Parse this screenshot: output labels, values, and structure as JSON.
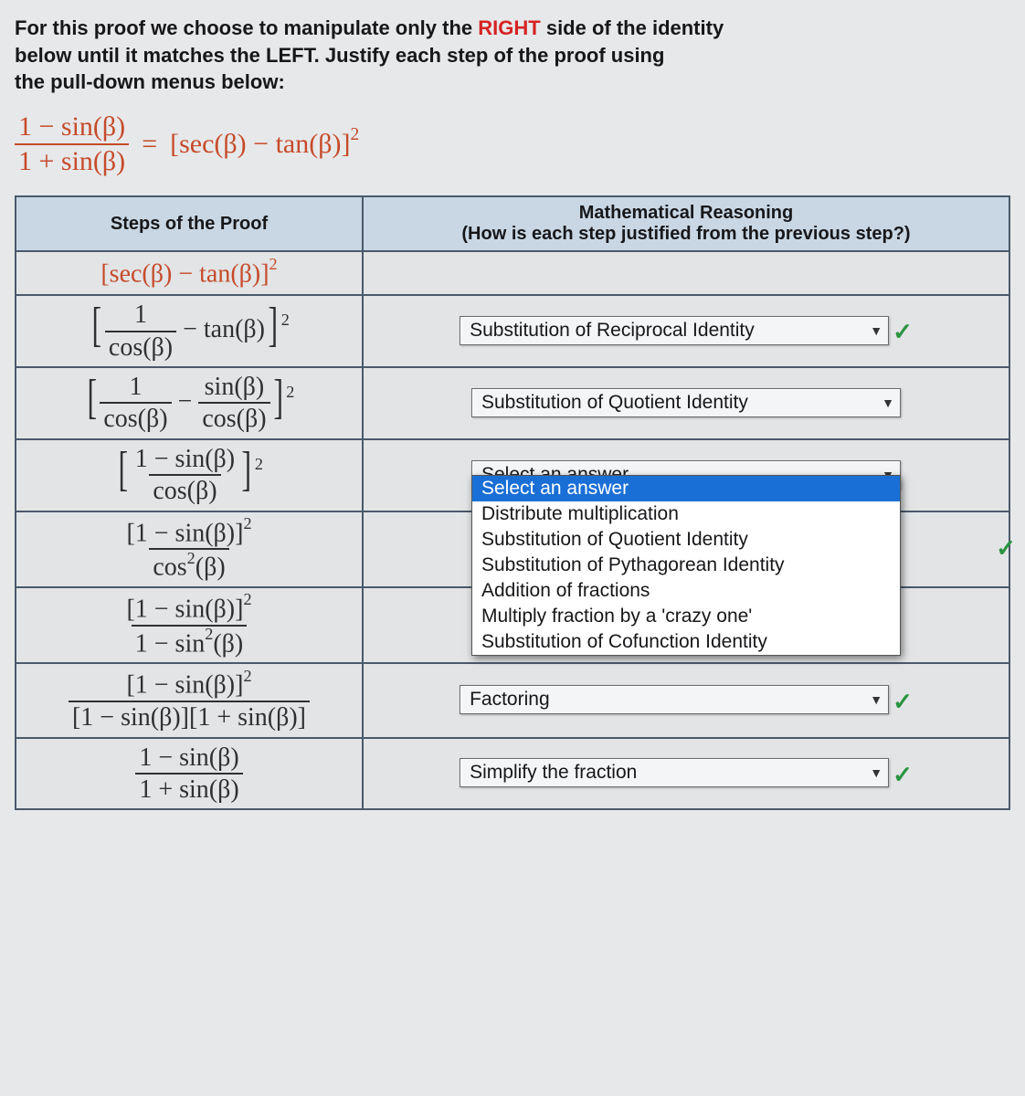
{
  "instructions": {
    "l1_pre": "For this proof we choose to manipulate only the ",
    "l1_right": "RIGHT",
    "l1_post": " side of the identity",
    "l2_pre": "below until it matches the ",
    "l2_left": "LEFT",
    "l2_post": ". Justify each step of the proof using",
    "l3": "the pull-down menus below:"
  },
  "identity": {
    "lhs_num": "1 − sin(β)",
    "lhs_den": "1 + sin(β)",
    "eq": "=",
    "rhs": "[sec(β) − tan(β)]",
    "rhs_exp": "2"
  },
  "table": {
    "h1": "Steps of the Proof",
    "h2a": "Mathematical Reasoning",
    "h2b": "(How is each step justified from the previous step?)"
  },
  "steps": {
    "s0_main": "[sec(β) − tan(β)]",
    "s0_exp": "2",
    "s1_num": "1",
    "s1_den": "cos(β)",
    "s1_tail": " − tan(β)",
    "s1_exp": "2",
    "s2_num1": "1",
    "s2_den1": "cos(β)",
    "s2_mid": " − ",
    "s2_num2": "sin(β)",
    "s2_den2": "cos(β)",
    "s2_exp": "2",
    "s3_num": "1 − sin(β)",
    "s3_den": "cos(β)",
    "s3_exp": "2",
    "s4_num": "[1 − sin(β)]",
    "s4_num_exp": "2",
    "s4_den": "cos",
    "s4_den_exp": "2",
    "s4_den_tail": "(β)",
    "s5_num": "[1 − sin(β)]",
    "s5_num_exp": "2",
    "s5_den_a": "1 − sin",
    "s5_den_exp": "2",
    "s5_den_b": "(β)",
    "s6_num": "[1 − sin(β)]",
    "s6_num_exp": "2",
    "s6_den": "[1 − sin(β)][1 + sin(β)]",
    "s7_num": "1 − sin(β)",
    "s7_den": "1 + sin(β)"
  },
  "reasons": {
    "r1": "Substitution of Reciprocal Identity",
    "r2": "Substitution of Quotient Identity",
    "r3_selected": "Select an answer",
    "r6": "Factoring",
    "r7": "Simplify the fraction"
  },
  "dropdown_options": [
    "Select an answer",
    "Distribute multiplication",
    "Substitution of Quotient Identity",
    "Substitution of Pythagorean Identity",
    "Addition of fractions",
    "Multiply fraction by a 'crazy one'",
    "Substitution of Cofunction Identity"
  ],
  "check": "✓"
}
